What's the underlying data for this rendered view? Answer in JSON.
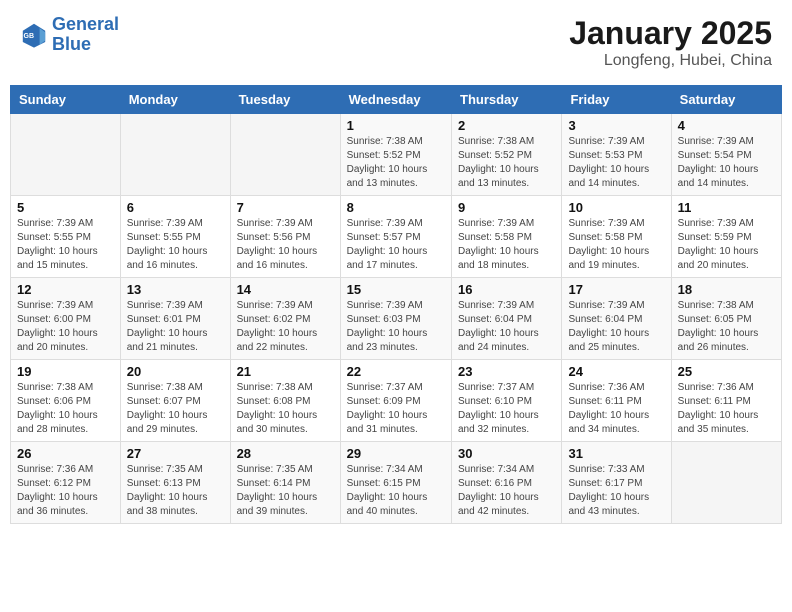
{
  "logo": {
    "line1": "General",
    "line2": "Blue"
  },
  "header": {
    "month": "January 2025",
    "location": "Longfeng, Hubei, China"
  },
  "weekdays": [
    "Sunday",
    "Monday",
    "Tuesday",
    "Wednesday",
    "Thursday",
    "Friday",
    "Saturday"
  ],
  "weeks": [
    [
      {
        "day": "",
        "info": ""
      },
      {
        "day": "",
        "info": ""
      },
      {
        "day": "",
        "info": ""
      },
      {
        "day": "1",
        "info": "Sunrise: 7:38 AM\nSunset: 5:52 PM\nDaylight: 10 hours and 13 minutes."
      },
      {
        "day": "2",
        "info": "Sunrise: 7:38 AM\nSunset: 5:52 PM\nDaylight: 10 hours and 13 minutes."
      },
      {
        "day": "3",
        "info": "Sunrise: 7:39 AM\nSunset: 5:53 PM\nDaylight: 10 hours and 14 minutes."
      },
      {
        "day": "4",
        "info": "Sunrise: 7:39 AM\nSunset: 5:54 PM\nDaylight: 10 hours and 14 minutes."
      }
    ],
    [
      {
        "day": "5",
        "info": "Sunrise: 7:39 AM\nSunset: 5:55 PM\nDaylight: 10 hours and 15 minutes."
      },
      {
        "day": "6",
        "info": "Sunrise: 7:39 AM\nSunset: 5:55 PM\nDaylight: 10 hours and 16 minutes."
      },
      {
        "day": "7",
        "info": "Sunrise: 7:39 AM\nSunset: 5:56 PM\nDaylight: 10 hours and 16 minutes."
      },
      {
        "day": "8",
        "info": "Sunrise: 7:39 AM\nSunset: 5:57 PM\nDaylight: 10 hours and 17 minutes."
      },
      {
        "day": "9",
        "info": "Sunrise: 7:39 AM\nSunset: 5:58 PM\nDaylight: 10 hours and 18 minutes."
      },
      {
        "day": "10",
        "info": "Sunrise: 7:39 AM\nSunset: 5:58 PM\nDaylight: 10 hours and 19 minutes."
      },
      {
        "day": "11",
        "info": "Sunrise: 7:39 AM\nSunset: 5:59 PM\nDaylight: 10 hours and 20 minutes."
      }
    ],
    [
      {
        "day": "12",
        "info": "Sunrise: 7:39 AM\nSunset: 6:00 PM\nDaylight: 10 hours and 20 minutes."
      },
      {
        "day": "13",
        "info": "Sunrise: 7:39 AM\nSunset: 6:01 PM\nDaylight: 10 hours and 21 minutes."
      },
      {
        "day": "14",
        "info": "Sunrise: 7:39 AM\nSunset: 6:02 PM\nDaylight: 10 hours and 22 minutes."
      },
      {
        "day": "15",
        "info": "Sunrise: 7:39 AM\nSunset: 6:03 PM\nDaylight: 10 hours and 23 minutes."
      },
      {
        "day": "16",
        "info": "Sunrise: 7:39 AM\nSunset: 6:04 PM\nDaylight: 10 hours and 24 minutes."
      },
      {
        "day": "17",
        "info": "Sunrise: 7:39 AM\nSunset: 6:04 PM\nDaylight: 10 hours and 25 minutes."
      },
      {
        "day": "18",
        "info": "Sunrise: 7:38 AM\nSunset: 6:05 PM\nDaylight: 10 hours and 26 minutes."
      }
    ],
    [
      {
        "day": "19",
        "info": "Sunrise: 7:38 AM\nSunset: 6:06 PM\nDaylight: 10 hours and 28 minutes."
      },
      {
        "day": "20",
        "info": "Sunrise: 7:38 AM\nSunset: 6:07 PM\nDaylight: 10 hours and 29 minutes."
      },
      {
        "day": "21",
        "info": "Sunrise: 7:38 AM\nSunset: 6:08 PM\nDaylight: 10 hours and 30 minutes."
      },
      {
        "day": "22",
        "info": "Sunrise: 7:37 AM\nSunset: 6:09 PM\nDaylight: 10 hours and 31 minutes."
      },
      {
        "day": "23",
        "info": "Sunrise: 7:37 AM\nSunset: 6:10 PM\nDaylight: 10 hours and 32 minutes."
      },
      {
        "day": "24",
        "info": "Sunrise: 7:36 AM\nSunset: 6:11 PM\nDaylight: 10 hours and 34 minutes."
      },
      {
        "day": "25",
        "info": "Sunrise: 7:36 AM\nSunset: 6:11 PM\nDaylight: 10 hours and 35 minutes."
      }
    ],
    [
      {
        "day": "26",
        "info": "Sunrise: 7:36 AM\nSunset: 6:12 PM\nDaylight: 10 hours and 36 minutes."
      },
      {
        "day": "27",
        "info": "Sunrise: 7:35 AM\nSunset: 6:13 PM\nDaylight: 10 hours and 38 minutes."
      },
      {
        "day": "28",
        "info": "Sunrise: 7:35 AM\nSunset: 6:14 PM\nDaylight: 10 hours and 39 minutes."
      },
      {
        "day": "29",
        "info": "Sunrise: 7:34 AM\nSunset: 6:15 PM\nDaylight: 10 hours and 40 minutes."
      },
      {
        "day": "30",
        "info": "Sunrise: 7:34 AM\nSunset: 6:16 PM\nDaylight: 10 hours and 42 minutes."
      },
      {
        "day": "31",
        "info": "Sunrise: 7:33 AM\nSunset: 6:17 PM\nDaylight: 10 hours and 43 minutes."
      },
      {
        "day": "",
        "info": ""
      }
    ]
  ]
}
